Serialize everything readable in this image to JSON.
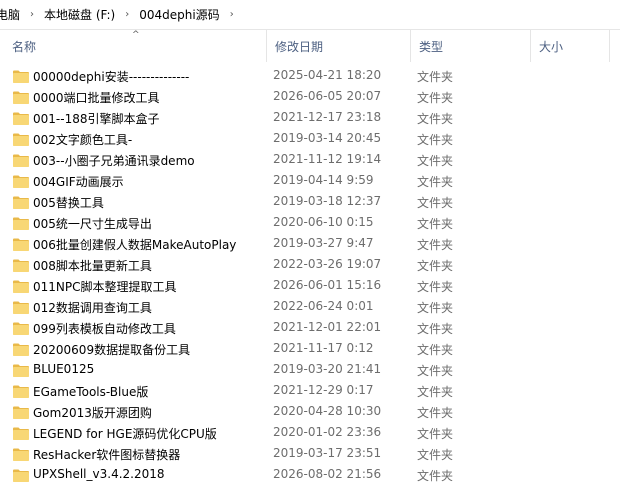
{
  "breadcrumb": {
    "items": [
      "电脑",
      "本地磁盘 (F:)",
      "004dephi源码"
    ],
    "separator": "›"
  },
  "columns": {
    "name": "名称",
    "date": "修改日期",
    "type": "类型",
    "size": "大小",
    "sort_indicator": "^"
  },
  "colors": {
    "folder_main": "#f8d775",
    "folder_dark": "#e9b949",
    "header_text": "#4d6082"
  },
  "icons": {
    "folder": "folder-icon"
  },
  "files": [
    {
      "name": "00000dephi安装--------------",
      "date": "2025-04-21 18:20",
      "type": "文件夹"
    },
    {
      "name": "0000端口批量修改工具",
      "date": "2026-06-05 20:07",
      "type": "文件夹"
    },
    {
      "name": "001--188引擎脚本盒子",
      "date": "2021-12-17 23:18",
      "type": "文件夹"
    },
    {
      "name": "002文字颜色工具-",
      "date": "2019-03-14 20:45",
      "type": "文件夹"
    },
    {
      "name": "003--小圈子兄弟通讯录demo",
      "date": "2021-11-12 19:14",
      "type": "文件夹"
    },
    {
      "name": "004GIF动画展示",
      "date": "2019-04-14 9:59",
      "type": "文件夹"
    },
    {
      "name": "005替换工具",
      "date": "2019-03-18 12:37",
      "type": "文件夹"
    },
    {
      "name": "005统一尺寸生成导出",
      "date": "2020-06-10 0:15",
      "type": "文件夹"
    },
    {
      "name": "006批量创建假人数据MakeAutoPlay",
      "date": "2019-03-27 9:47",
      "type": "文件夹"
    },
    {
      "name": "008脚本批量更新工具",
      "date": "2022-03-26 19:07",
      "type": "文件夹"
    },
    {
      "name": "011NPC脚本整理提取工具",
      "date": "2026-06-01 15:16",
      "type": "文件夹"
    },
    {
      "name": "012数据调用查询工具",
      "date": "2022-06-24 0:01",
      "type": "文件夹"
    },
    {
      "name": "099列表模板自动修改工具",
      "date": "2021-12-01 22:01",
      "type": "文件夹"
    },
    {
      "name": "20200609数据提取备份工具",
      "date": "2021-11-17 0:12",
      "type": "文件夹"
    },
    {
      "name": "BLUE0125",
      "date": "2019-03-20 21:41",
      "type": "文件夹"
    },
    {
      "name": "EGameTools-Blue版",
      "date": "2021-12-29 0:17",
      "type": "文件夹"
    },
    {
      "name": "Gom2013版开源团购",
      "date": "2020-04-28 10:30",
      "type": "文件夹"
    },
    {
      "name": "LEGEND for HGE源码优化CPU版",
      "date": "2020-01-02 23:36",
      "type": "文件夹"
    },
    {
      "name": "ResHacker软件图标替换器",
      "date": "2019-03-17 23:51",
      "type": "文件夹"
    },
    {
      "name": "UPXShell_v3.4.2.2018",
      "date": "2026-08-02 21:56",
      "type": "文件夹"
    }
  ]
}
